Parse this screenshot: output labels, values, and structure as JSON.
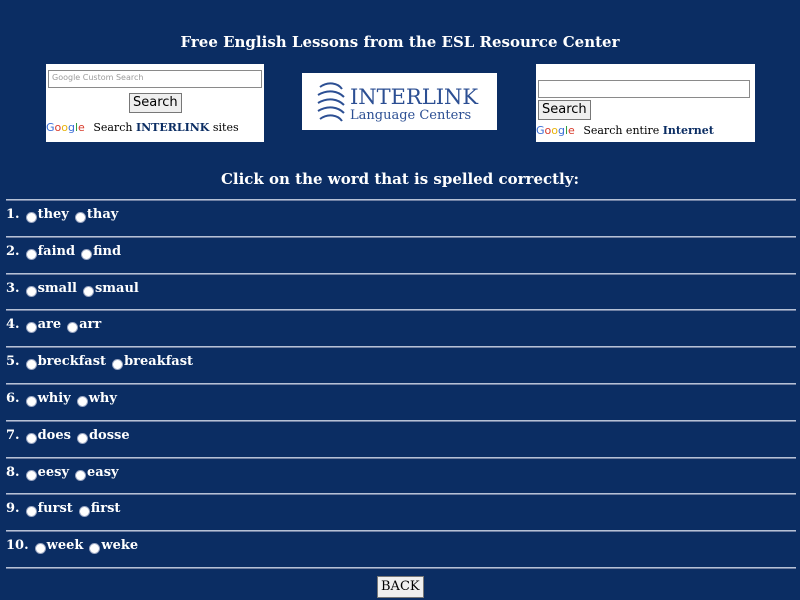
{
  "header": {
    "title": "Free English Lessons from the ESL Resource Center"
  },
  "left_search": {
    "placeholder": "Custom Search",
    "button_label": "Search",
    "caption_prefix": "Search",
    "caption_brand": "INTERLINK",
    "caption_suffix": "sites"
  },
  "logo": {
    "name": "INTERLINK",
    "subtitle": "Language Centers"
  },
  "right_search": {
    "value": "",
    "button_label": "Search",
    "caption_prefix": "Search entire",
    "caption_brand": "Internet"
  },
  "google_text": "Google",
  "instruction": "Click on the word that is spelled correctly:",
  "questions": [
    {
      "number": "1.",
      "options": [
        "they",
        "thay"
      ]
    },
    {
      "number": "2.",
      "options": [
        "faind",
        "find"
      ]
    },
    {
      "number": "3.",
      "options": [
        "small",
        "smaul"
      ]
    },
    {
      "number": "4.",
      "options": [
        "are",
        "arr"
      ]
    },
    {
      "number": "5.",
      "options": [
        "breckfast",
        "breakfast"
      ]
    },
    {
      "number": "6.",
      "options": [
        "whiy",
        "why"
      ]
    },
    {
      "number": "7.",
      "options": [
        "does",
        "dosse"
      ]
    },
    {
      "number": "8.",
      "options": [
        "eesy",
        "easy"
      ]
    },
    {
      "number": "9.",
      "options": [
        "furst",
        "first"
      ]
    },
    {
      "number": "10.",
      "options": [
        "week",
        "weke"
      ]
    }
  ],
  "back_button": "BACK",
  "colors": {
    "background": "#0b2d63",
    "text": "#ffffff",
    "brand": "#2c4f93"
  }
}
